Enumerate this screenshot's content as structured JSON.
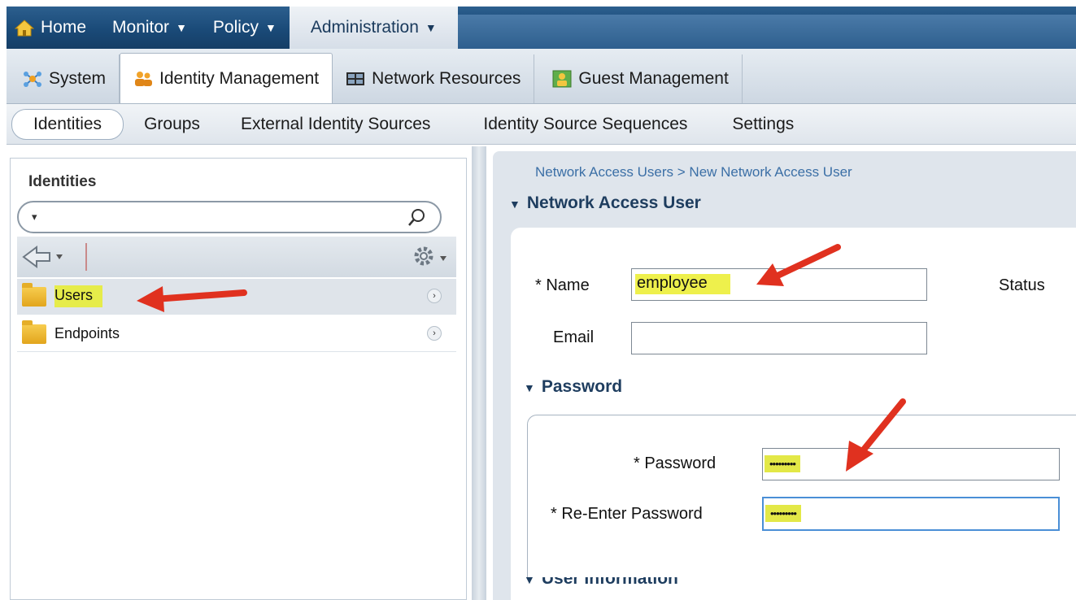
{
  "topnav": {
    "items": [
      {
        "label": "Home",
        "icon": "home-icon",
        "caret": ""
      },
      {
        "label": "Monitor",
        "caret": "▼"
      },
      {
        "label": "Policy",
        "caret": "▼"
      },
      {
        "label": "Administration",
        "caret": "▼"
      }
    ]
  },
  "tabs": [
    {
      "label": "System",
      "icon": "system-icon"
    },
    {
      "label": "Identity Management",
      "icon": "users-icon"
    },
    {
      "label": "Network Resources",
      "icon": "network-icon"
    },
    {
      "label": "Guest Management",
      "icon": "guest-icon"
    }
  ],
  "subnav": [
    "Identities",
    "Groups",
    "External Identity Sources",
    "Identity Source Sequences",
    "Settings"
  ],
  "left": {
    "title": "Identities",
    "search_dropdown": "▾",
    "tree": [
      {
        "label": "Users"
      },
      {
        "label": "Endpoints"
      }
    ]
  },
  "right": {
    "breadcrumb": "Network Access Users > New Network Access User",
    "section_user": "Network Access User",
    "name_label": "* Name",
    "name_value": "employee",
    "status_label": "Status",
    "email_label": "Email",
    "email_value": "",
    "section_password": "Password",
    "password_label": "* Password",
    "password_value": "•••••••••",
    "reenter_label": "* Re-Enter Password",
    "reenter_value": "•••••••••",
    "section_userinfo": "User Information"
  },
  "colors": {
    "nav_dark": "#1a4a78",
    "highlight": "#e6ec4a",
    "arrow_red": "#e0311f",
    "link_blue": "#3b6fa6",
    "section_title": "#1e3d5f"
  }
}
